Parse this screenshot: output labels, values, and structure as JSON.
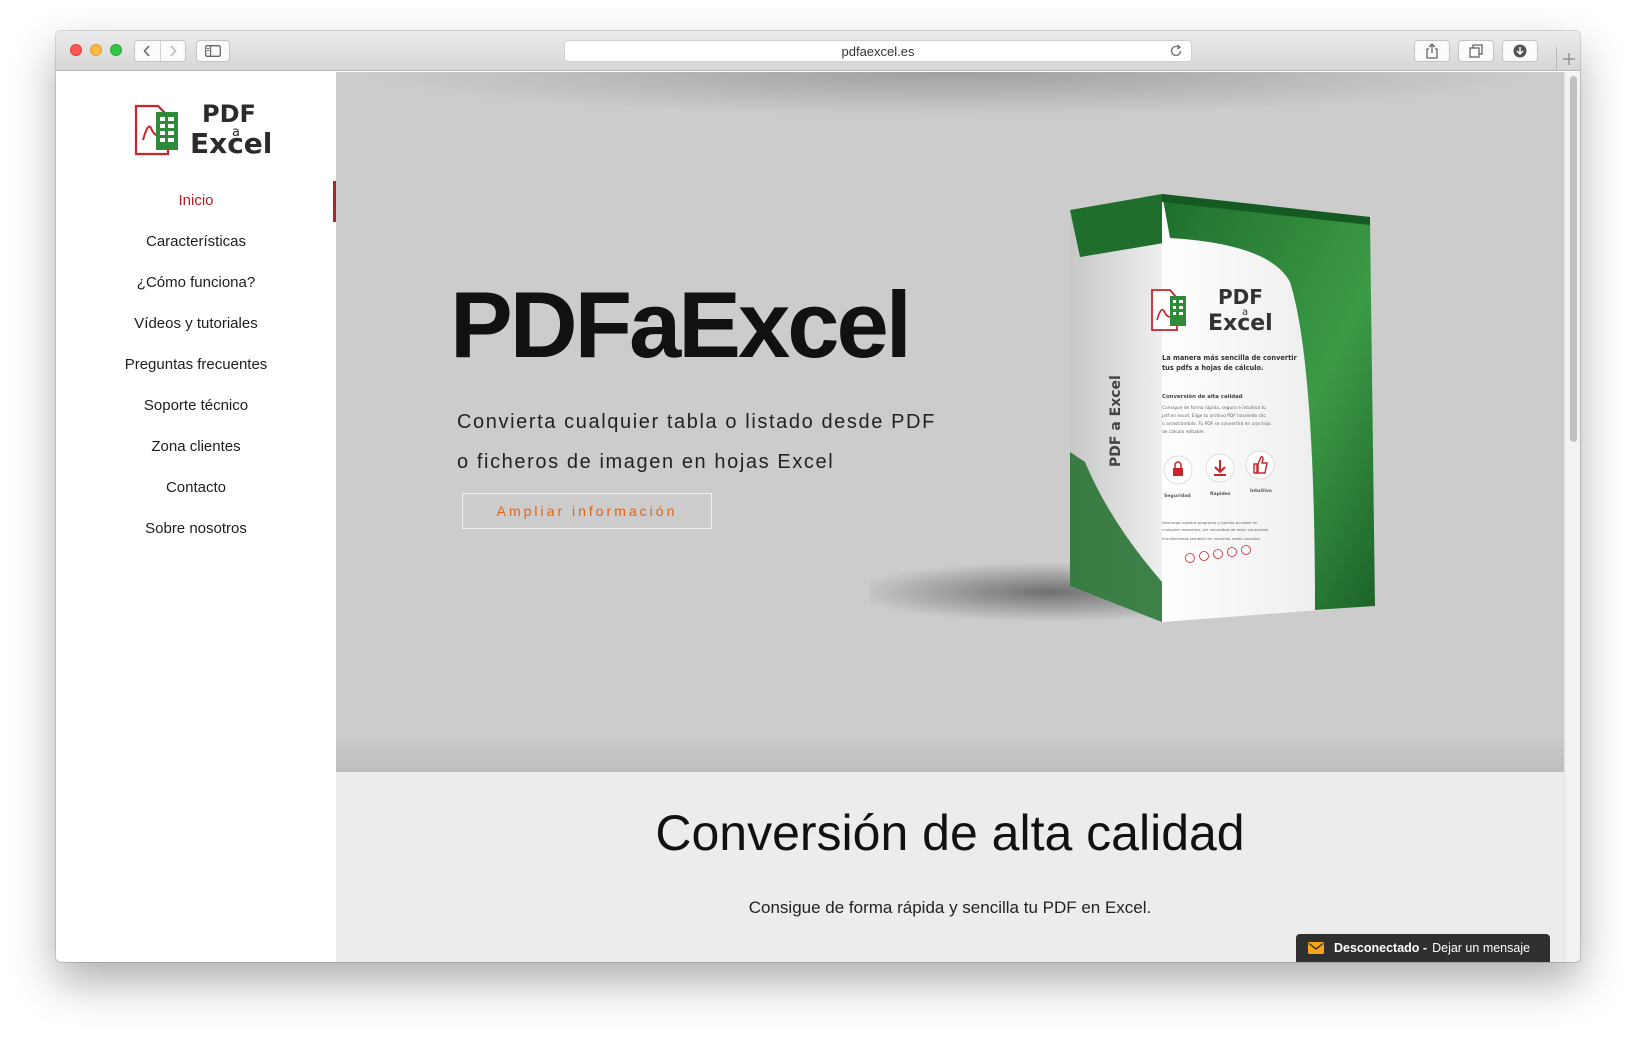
{
  "browser": {
    "url": "pdfaexcel.es"
  },
  "logo": {
    "line1": "PDF",
    "line2": "a",
    "line3": "Excel"
  },
  "nav": {
    "items": [
      {
        "label": "Inicio"
      },
      {
        "label": "Características"
      },
      {
        "label": "¿Cómo funciona?"
      },
      {
        "label": "Vídeos y tutoriales"
      },
      {
        "label": "Preguntas frecuentes"
      },
      {
        "label": "Soporte técnico"
      },
      {
        "label": "Zona clientes"
      },
      {
        "label": "Contacto"
      },
      {
        "label": "Sobre nosotros"
      }
    ]
  },
  "hero": {
    "title": "PDFaExcel",
    "subtitle_line1": "Convierta cualquier tabla o listado desde PDF",
    "subtitle_line2": "o ficheros de imagen en hojas Excel",
    "cta": "Ampliar información"
  },
  "box": {
    "logo_line1": "PDF",
    "logo_line2": "a",
    "logo_line3": "Excel",
    "spine_text": "PDF a Excel",
    "tagline_line1": "La manera más sencilla de convertir",
    "tagline_line2": "tus pdfs a hojas de cálculo.",
    "heading": "Conversión de alta calidad",
    "body_line1": "Consigue de forma rápida, segura e intuitiva tu",
    "body_line2": "pdf en excel. Elige tu archivo PDF haciendo clic",
    "body_line3": "o arrastrándolo. Tu PDF se convertirá en una hoja",
    "body_line4": "de cálculo editable.",
    "feature1": "Seguridad",
    "feature2": "Rapidez",
    "feature3": "Intuitivo",
    "foot_line1": "Descarga nuestro programa y podrás acceder en",
    "foot_line2": "cualquier momento, sin necesidad de estar conectado.",
    "foot_line3": "Encuéntranos también en nuestras redes sociales:"
  },
  "section": {
    "title": "Conversión de alta calidad",
    "text": "Consigue de forma rápida y sencilla tu PDF en Excel."
  },
  "chat": {
    "status": "Desconectado -",
    "action": "Dejar un mensaje"
  },
  "colors": {
    "brand_red": "#b61f24",
    "brand_green": "#2e7d32",
    "cta_orange": "#e8620f"
  }
}
